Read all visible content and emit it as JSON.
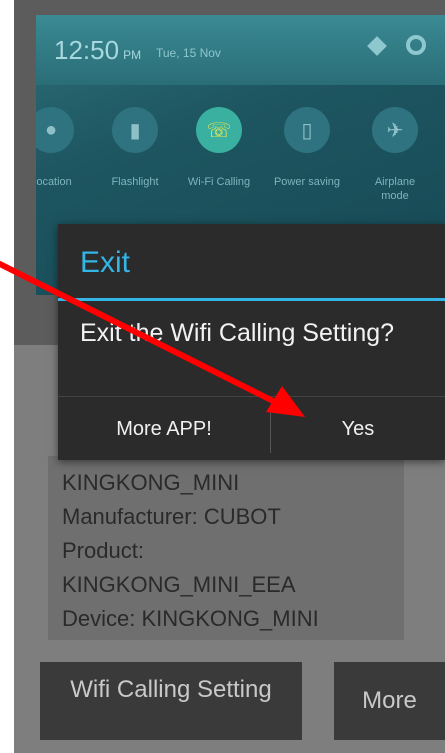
{
  "statusbar": {
    "time": "12:50",
    "ampm": "PM",
    "date": "Tue, 15 Nov"
  },
  "quick_settings": [
    {
      "label": "Location",
      "icon": "location-pin-icon"
    },
    {
      "label": "Flashlight",
      "icon": "flashlight-icon"
    },
    {
      "label": "Wi-Fi Calling",
      "icon": "wifi-calling-icon",
      "active": true
    },
    {
      "label": "Power saving",
      "icon": "battery-icon"
    },
    {
      "label": "Airplane mode",
      "icon": "airplane-icon"
    }
  ],
  "dialog": {
    "title": "Exit",
    "message": "Exit the Wifi Calling Setting?",
    "btn_more": "More APP!",
    "btn_yes": "Yes"
  },
  "device_info": [
    "KINGKONG_MINI",
    "Manufacturer: CUBOT",
    "Product:",
    "KINGKONG_MINI_EEA",
    "Device: KINGKONG_MINI"
  ],
  "buttons": {
    "wifi_calling_setting": "Wifi Calling Setting",
    "more": "More"
  },
  "colors": {
    "accent": "#33b5e5",
    "arrow": "#ff0000"
  }
}
